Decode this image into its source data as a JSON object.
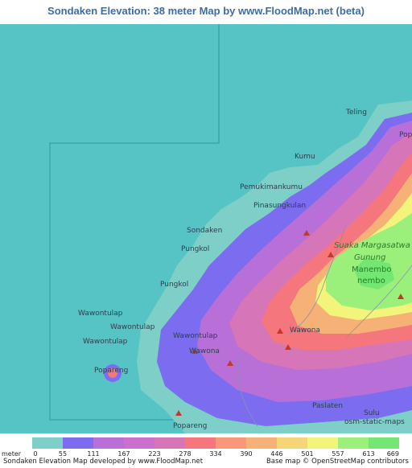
{
  "title": "Sondaken Elevation: 38 meter Map by www.FloodMap.net (beta)",
  "map_labels": {
    "teling": "Teling",
    "popo": "Popo",
    "kumu": "Kumu",
    "pemukiman": "Pemukimankumu",
    "pinasungkulan": "Pinasungkulan",
    "sondaken": "Sondaken",
    "pungkol1": "Pungkol",
    "pungkol2": "Pungkol",
    "suaka": "Suaka Margasatwa",
    "gunung": "Gunung",
    "manembo": "Manembo",
    "nembo": "nembo",
    "wawontulap1": "Wawontulap",
    "wawontulap2": "Wawontulap",
    "wawontulap3": "Wawontulap",
    "wawontulap4": "Wawontulap",
    "wawona1": "Wawona",
    "wawona2": "Wawona",
    "popareng1": "Popareng",
    "popareng2": "Popareng",
    "paslaten": "Paslaten",
    "sulu": "Sulu",
    "osm": "osm-static-maps"
  },
  "legend": {
    "unit": "meter",
    "ticks": [
      "0",
      "55",
      "111",
      "167",
      "223",
      "278",
      "334",
      "390",
      "446",
      "501",
      "557",
      "613",
      "669"
    ],
    "colors": [
      "#7dcfc7",
      "#7b6cf0",
      "#b870d8",
      "#cc70d0",
      "#d676b8",
      "#f5767c",
      "#f8977a",
      "#f6b276",
      "#f5d577",
      "#f2f57a",
      "#9bf07c",
      "#73e674"
    ]
  },
  "footer": {
    "left": "Sondaken Elevation Map developed by www.FloodMap.net",
    "right": "Base map © OpenStreetMap contributors"
  },
  "colors": {
    "sea": "#56c4c4",
    "title": "#3a6ea5"
  }
}
